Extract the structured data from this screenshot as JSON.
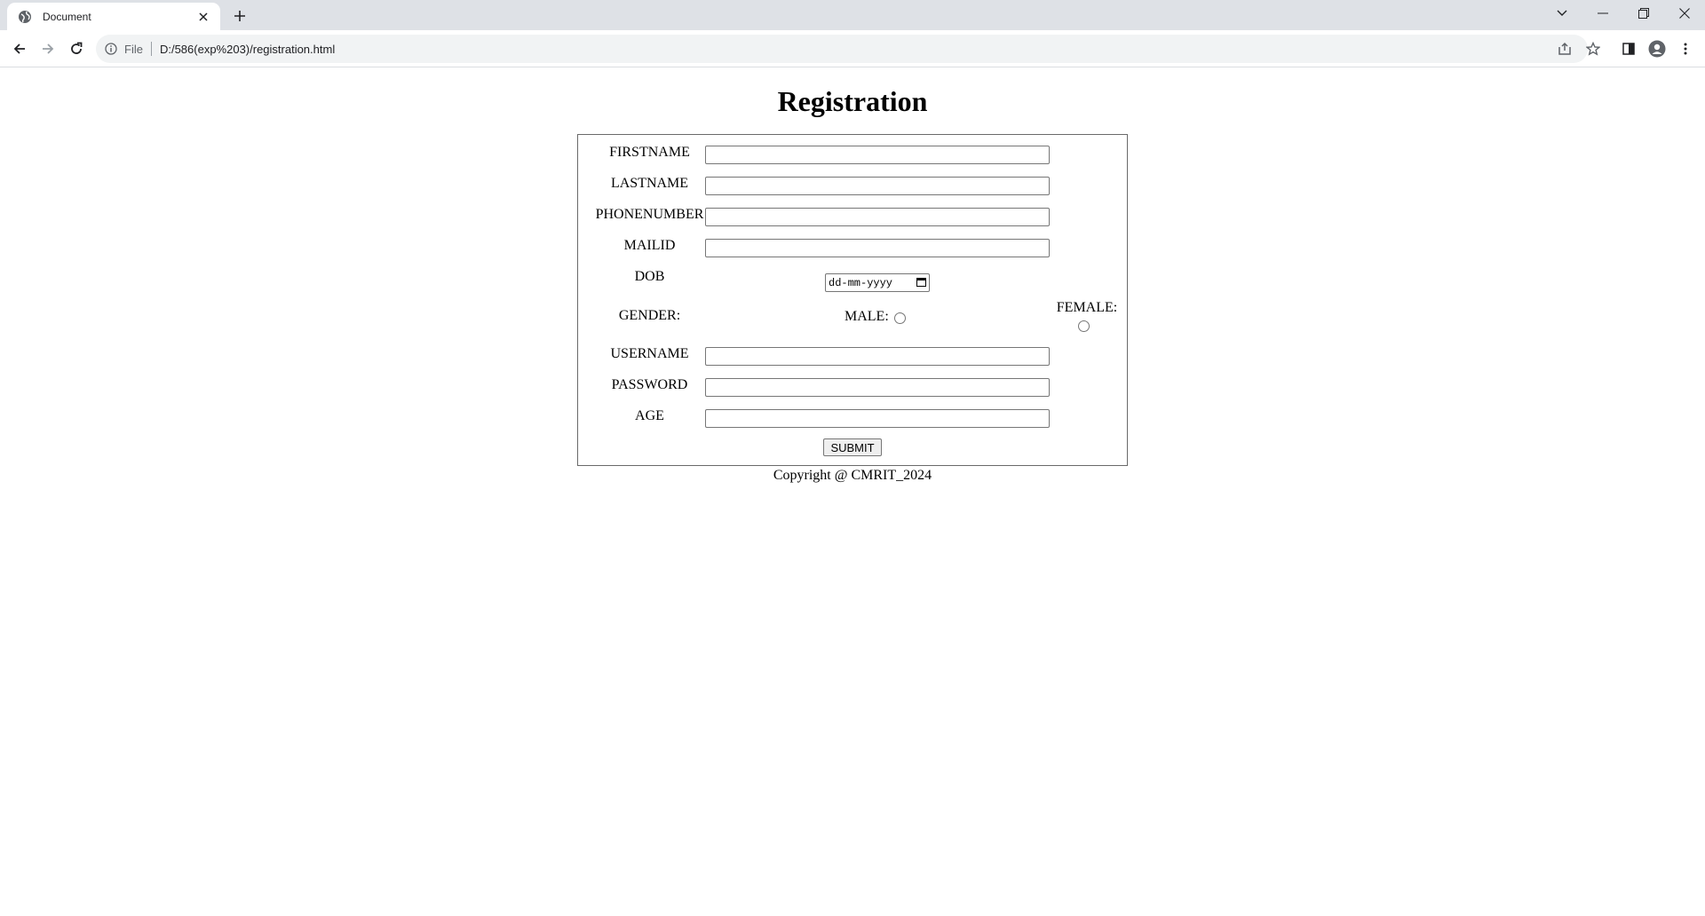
{
  "browser": {
    "tab_title": "Document",
    "url_scheme": "File",
    "url": "D:/586(exp%203)/registration.html"
  },
  "page": {
    "heading": "Registration",
    "fields": {
      "firstname_label": "FIRSTNAME",
      "firstname_value": "",
      "lastname_label": "LASTNAME",
      "lastname_value": "",
      "phone_label": "PHONENUMBER",
      "phone_value": "",
      "mail_label": "MAILID",
      "mail_value": "",
      "dob_label": "DOB",
      "dob_placeholder": "dd-mm-yyyy",
      "gender_label": "GENDER:",
      "male_label": "MALE:",
      "female_label": "FEMALE:",
      "username_label": "USERNAME",
      "username_value": "",
      "password_label": "PASSWORD",
      "password_value": "",
      "age_label": "AGE",
      "age_value": ""
    },
    "submit_label": "SUBMIT",
    "copyright": "Copyright @ CMRIT_2024"
  },
  "icons": {
    "tab_favicon": "globe-icon",
    "tab_close": "close-icon",
    "new_tab": "plus-icon",
    "tab_search": "chevron-down-icon",
    "minimize": "minimize-icon",
    "restore": "restore-icon",
    "close_window": "close-window-icon",
    "back": "arrow-left-icon",
    "forward": "arrow-right-icon",
    "reload": "reload-icon",
    "site_info": "info-icon",
    "share": "share-icon",
    "bookmark": "star-icon",
    "side_panel": "side-panel-icon",
    "profile": "profile-icon",
    "menu": "kebab-menu-icon"
  }
}
